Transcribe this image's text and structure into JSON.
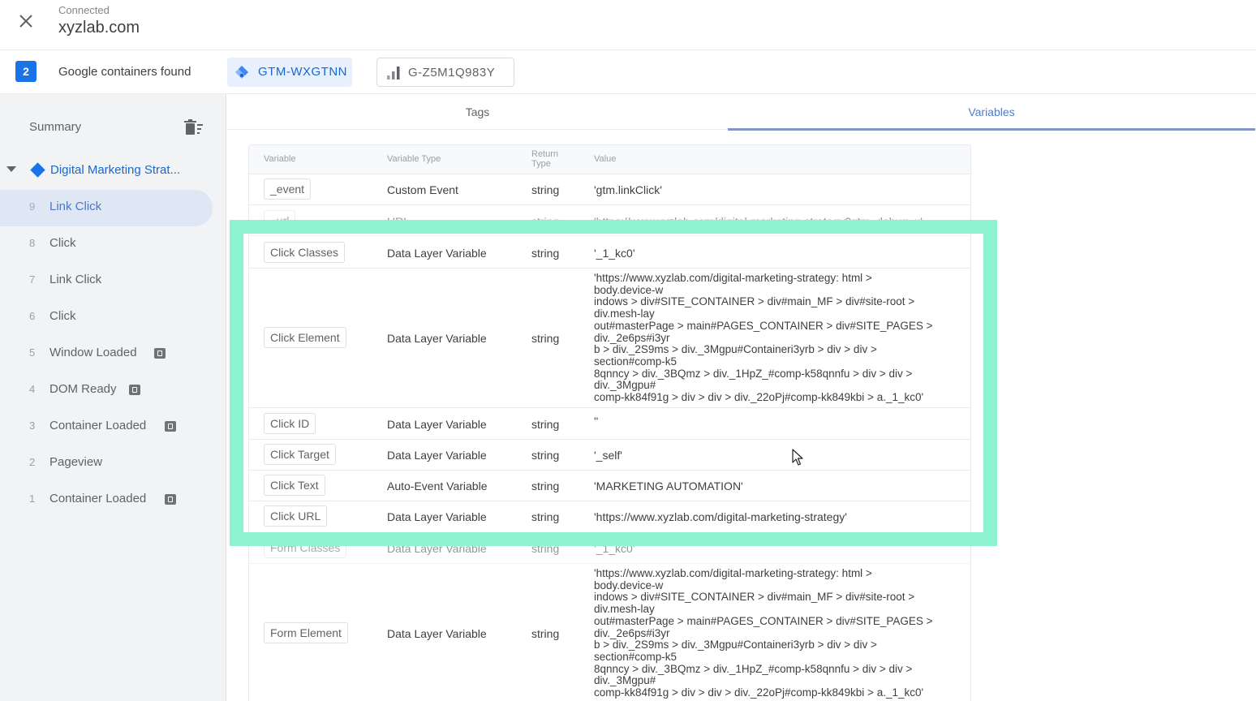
{
  "header": {
    "connection_status": "Connected",
    "domain": "xyzlab.com"
  },
  "containers": {
    "count": "2",
    "found_label": "Google containers found",
    "gtm_id": "GTM-WXGTNN",
    "ga_id": "G-Z5M1Q983Y"
  },
  "sidebar": {
    "summary_label": "Summary",
    "page_label": "Digital Marketing Strat...",
    "events": [
      {
        "num": "9",
        "name": "Link Click",
        "selected": true,
        "has_icon": false
      },
      {
        "num": "8",
        "name": "Click",
        "has_icon": false
      },
      {
        "num": "7",
        "name": "Link Click",
        "has_icon": false
      },
      {
        "num": "6",
        "name": "Click",
        "has_icon": false
      },
      {
        "num": "5",
        "name": "Window Loaded",
        "has_icon": true
      },
      {
        "num": "4",
        "name": "DOM Ready",
        "has_icon": true
      },
      {
        "num": "3",
        "name": "Container Loaded",
        "has_icon": true
      },
      {
        "num": "2",
        "name": "Pageview",
        "has_icon": false
      },
      {
        "num": "1",
        "name": "Container Loaded",
        "has_icon": true
      }
    ]
  },
  "tabs": {
    "tags": "Tags",
    "variables": "Variables"
  },
  "table": {
    "headers": {
      "variable": "Variable",
      "variable_type": "Variable Type",
      "return_type": "Return Type",
      "value": "Value"
    },
    "rows": [
      {
        "name": "_event",
        "type": "Custom Event",
        "rtype": "string",
        "value": "'gtm.linkClick'"
      },
      {
        "name": "_url",
        "type": "URL",
        "rtype": "string",
        "value": "'https://www.xyzlab.com/digital-marketing-strategy?gtm_debug=x'"
      },
      {
        "name": "Click Classes",
        "type": "Data Layer Variable",
        "rtype": "string",
        "value": "'_1_kc0'"
      },
      {
        "name": "Click Element",
        "type": "Data Layer Variable",
        "rtype": "string",
        "value": "'https://www.xyzlab.com/digital-marketing-strategy: html >\nbody.device-w\nindows > div#SITE_CONTAINER > div#main_MF > div#site-root >\ndiv.mesh-lay\nout#masterPage > main#PAGES_CONTAINER > div#SITE_PAGES >\ndiv._2e6ps#i3yr\nb > div._2S9ms > div._3Mgpu#Containeri3yrb > div > div >\nsection#comp-k5\n8qnncy > div._3BQmz > div._1HpZ_#comp-k58qnnfu > div > div >\ndiv._3Mgpu#\ncomp-kk84f91g > div > div > div._22oPj#comp-kk849kbi > a._1_kc0'"
      },
      {
        "name": "Click ID",
        "type": "Data Layer Variable",
        "rtype": "string",
        "value": "''"
      },
      {
        "name": "Click Target",
        "type": "Data Layer Variable",
        "rtype": "string",
        "value": "'_self'"
      },
      {
        "name": "Click Text",
        "type": "Auto-Event Variable",
        "rtype": "string",
        "value": "'MARKETING AUTOMATION'"
      },
      {
        "name": "Click URL",
        "type": "Data Layer Variable",
        "rtype": "string",
        "value": "'https://www.xyzlab.com/digital-marketing-strategy'"
      },
      {
        "name": "Form Classes",
        "type": "Data Layer Variable",
        "rtype": "string",
        "value": "'_1_kc0'"
      },
      {
        "name": "Form Element",
        "type": "Data Layer Variable",
        "rtype": "string",
        "value": "'https://www.xyzlab.com/digital-marketing-strategy: html >\nbody.device-w\nindows > div#SITE_CONTAINER > div#main_MF > div#site-root >\ndiv.mesh-lay\nout#masterPage > main#PAGES_CONTAINER > div#SITE_PAGES >\ndiv._2e6ps#i3yr\nb > div._2S9ms > div._3Mgpu#Containeri3yrb > div > div >\nsection#comp-k5\n8qnncy > div._3BQmz > div._1HpZ_#comp-k58qnnfu > div > div >\ndiv._3Mgpu#\ncomp-kk84f91g > div > div > div._22oPj#comp-kk849kbi > a._1_kc0'"
      }
    ]
  },
  "colors": {
    "accent": "#1a73e8",
    "highlight": "#8df3d1"
  },
  "icons": [
    "close-icon",
    "gtm-icon",
    "ga-bar-chart-icon",
    "delete-sweep-icon",
    "expand-caret-icon",
    "page-diamond-icon",
    "event-code-icon",
    "mouse-cursor-icon"
  ]
}
